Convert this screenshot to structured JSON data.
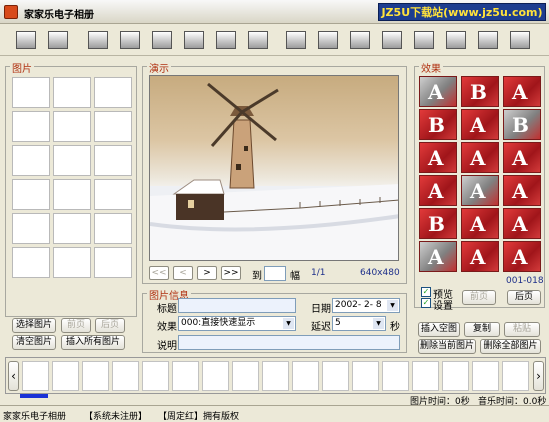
{
  "window": {
    "title": "家家乐电子相册",
    "watermark": "JZ5U下载站(www.jz5u.com)"
  },
  "toolbar": {
    "icons": [
      "add-picture-icon",
      "open-folder-icon",
      "save-icon",
      "copy-pages-icon",
      "new-document-icon",
      "open-document-icon",
      "save-document-icon",
      "text-doc-icon",
      "edit-icon",
      "film-icon",
      "music-icon",
      "camera-icon",
      "magnify-icon",
      "video-icon",
      "cd-icon",
      "exit-icon"
    ]
  },
  "pictures_panel": {
    "label": "图片",
    "buttons": {
      "select": "选择图片",
      "prev": "前页",
      "next": "后页",
      "clear": "清空图片",
      "insert_all": "插入所有图片"
    }
  },
  "preview_panel": {
    "label": "演示",
    "nav": {
      "first": "<<",
      "prev": "<",
      "next": ">",
      "last": ">>",
      "goto_prefix": "到",
      "goto_suffix": "幅",
      "goto_value": "",
      "page_count": "1/1",
      "resolution": "640x480"
    }
  },
  "info_panel": {
    "label": "图片信息",
    "title_label": "标题",
    "title_value": "",
    "date_label": "日期",
    "date_value": "2002- 2- 8",
    "effect_label": "效果",
    "effect_value": "000:直接快速显示",
    "delay_label": "延迟",
    "delay_value": "5",
    "delay_unit": "秒",
    "desc_label": "说明",
    "desc_value": ""
  },
  "effects_panel": {
    "label": "效果",
    "range": "001-018",
    "preview_label": "预览",
    "preview_checked": true,
    "settings_label": "设置",
    "settings_checked": true,
    "prev": "前页",
    "next": "后页",
    "tiles": [
      "A",
      "B",
      "A",
      "B",
      "A",
      "B",
      "A",
      "A",
      "A",
      "A",
      "A",
      "A",
      "B",
      "A",
      "A",
      "A",
      "A",
      "A"
    ]
  },
  "actions": {
    "insert_blank": "插入空图",
    "copy": "复制",
    "paste": "粘贴",
    "delete_current": "删除当前图片",
    "delete_all": "删除全部图片"
  },
  "filmstrip": {
    "left_arrow": "‹",
    "right_arrow": "›",
    "picture_time": "图片时间：0秒",
    "music_time": "音乐时间：0.0秒"
  },
  "status": {
    "app": "家家乐电子相册",
    "registration": "【系统未注册】",
    "copyright": "【周定红】拥有版权"
  }
}
